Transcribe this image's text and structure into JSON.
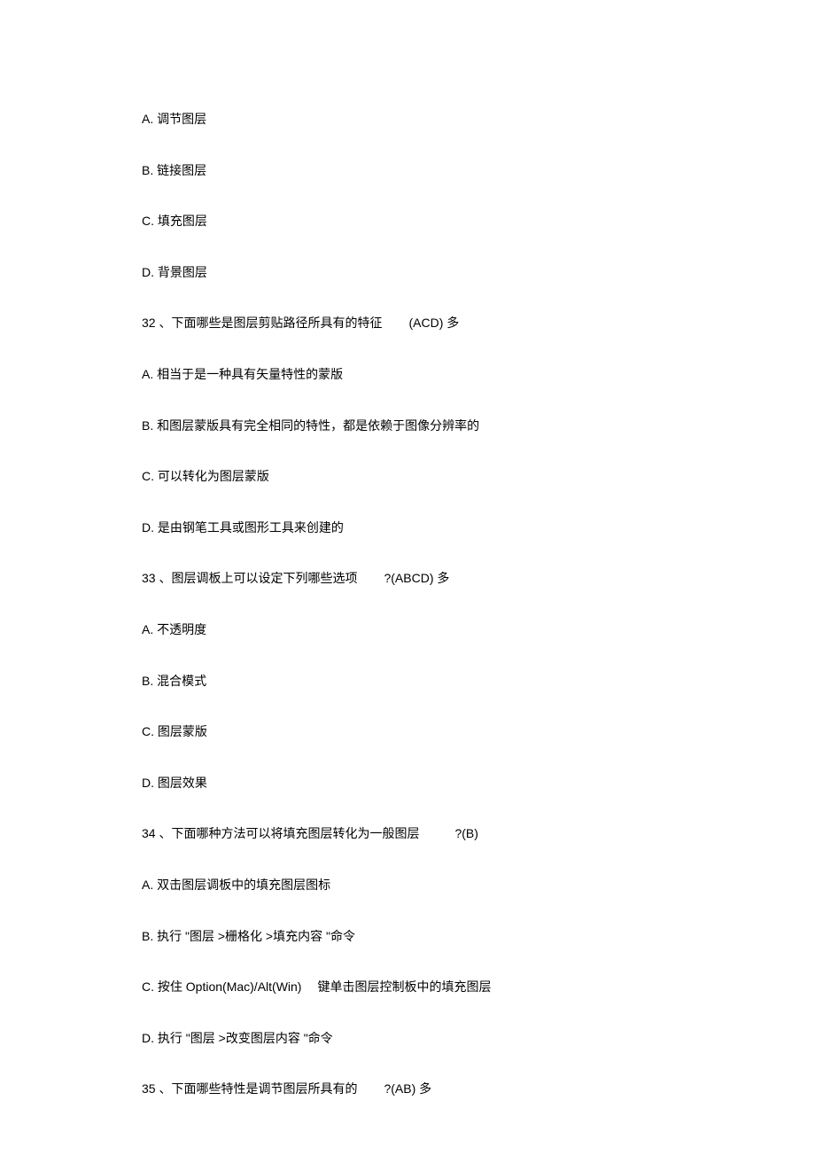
{
  "lines": [
    {
      "text": "A. 调节图层"
    },
    {
      "text": "B. 链接图层"
    },
    {
      "text": "C. 填充图层"
    },
    {
      "text": "D. 背景图层"
    },
    {
      "parts": [
        "32 、下面哪些是图层剪贴路径所具有的特征",
        "(ACD) 多"
      ],
      "gap": "s"
    },
    {
      "text": "A. 相当于是一种具有矢量特性的蒙版"
    },
    {
      "text": "B. 和图层蒙版具有完全相同的特性，都是依赖于图像分辨率的"
    },
    {
      "text": "C. 可以转化为图层蒙版"
    },
    {
      "text": "D. 是由钢笔工具或图形工具来创建的"
    },
    {
      "parts": [
        "33 、图层调板上可以设定下列哪些选项",
        "?(ABCD) 多"
      ],
      "gap": "s"
    },
    {
      "text": "A. 不透明度"
    },
    {
      "text": "B. 混合模式"
    },
    {
      "text": "C. 图层蒙版"
    },
    {
      "text": "D. 图层效果"
    },
    {
      "parts": [
        "34 、下面哪种方法可以将填充图层转化为一般图层",
        "?(B)"
      ],
      "gap": "m"
    },
    {
      "text": "A. 双击图层调板中的填充图层图标"
    },
    {
      "text": "B. 执行 \"图层 >栅格化 >填充内容 \"命令"
    },
    {
      "parts": [
        "C. 按住 Option(Mac)/Alt(Win)",
        "键单击图层控制板中的填充图层"
      ],
      "gap": "xs"
    },
    {
      "text": "D. 执行 \"图层 >改变图层内容 \"命令"
    },
    {
      "parts": [
        "35 、下面哪些特性是调节图层所具有的",
        "?(AB) 多"
      ],
      "gap": "s"
    }
  ]
}
